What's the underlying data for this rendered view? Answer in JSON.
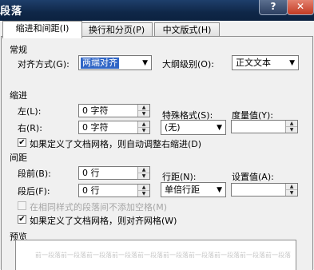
{
  "window": {
    "title": "段落",
    "help_label": "?",
    "close_label": "✕"
  },
  "tabs": [
    {
      "label": "缩进和间距(I)"
    },
    {
      "label": "换行和分页(P)"
    },
    {
      "label": "中文版式(H)"
    }
  ],
  "general": {
    "section_label": "常规",
    "alignment_label": "对齐方式(G):",
    "alignment_value": "两端对齐",
    "outline_label": "大纲级别(O):",
    "outline_value": "正文文本"
  },
  "indent": {
    "section_label": "缩进",
    "left_label": "左(L):",
    "left_value": "0 字符",
    "right_label": "右(R):",
    "right_value": "0 字符",
    "special_label": "特殊格式(S):",
    "special_value": "(无)",
    "measure_label": "度量值(Y):",
    "measure_value": "",
    "auto_adjust_label": "如果定义了文档网格，则自动调整右缩进(D)",
    "auto_adjust_checked": true
  },
  "spacing": {
    "section_label": "间距",
    "before_label": "段前(B):",
    "before_value": "0 行",
    "after_label": "段后(F):",
    "after_value": "0 行",
    "line_label": "行距(N):",
    "line_value": "单倍行距",
    "setting_label": "设置值(A):",
    "setting_value": "",
    "no_space_label": "在相同样式的段落间不添加空格(M)",
    "no_space_checked": false,
    "snap_grid_label": "如果定义了文档网格，则对齐网格(W)",
    "snap_grid_checked": true
  },
  "preview": {
    "section_label": "预览",
    "sample_text": "前一段落前一段落前一段落前一段落前一段落前一段落前一段落前一段落前一段落前一段落"
  }
}
